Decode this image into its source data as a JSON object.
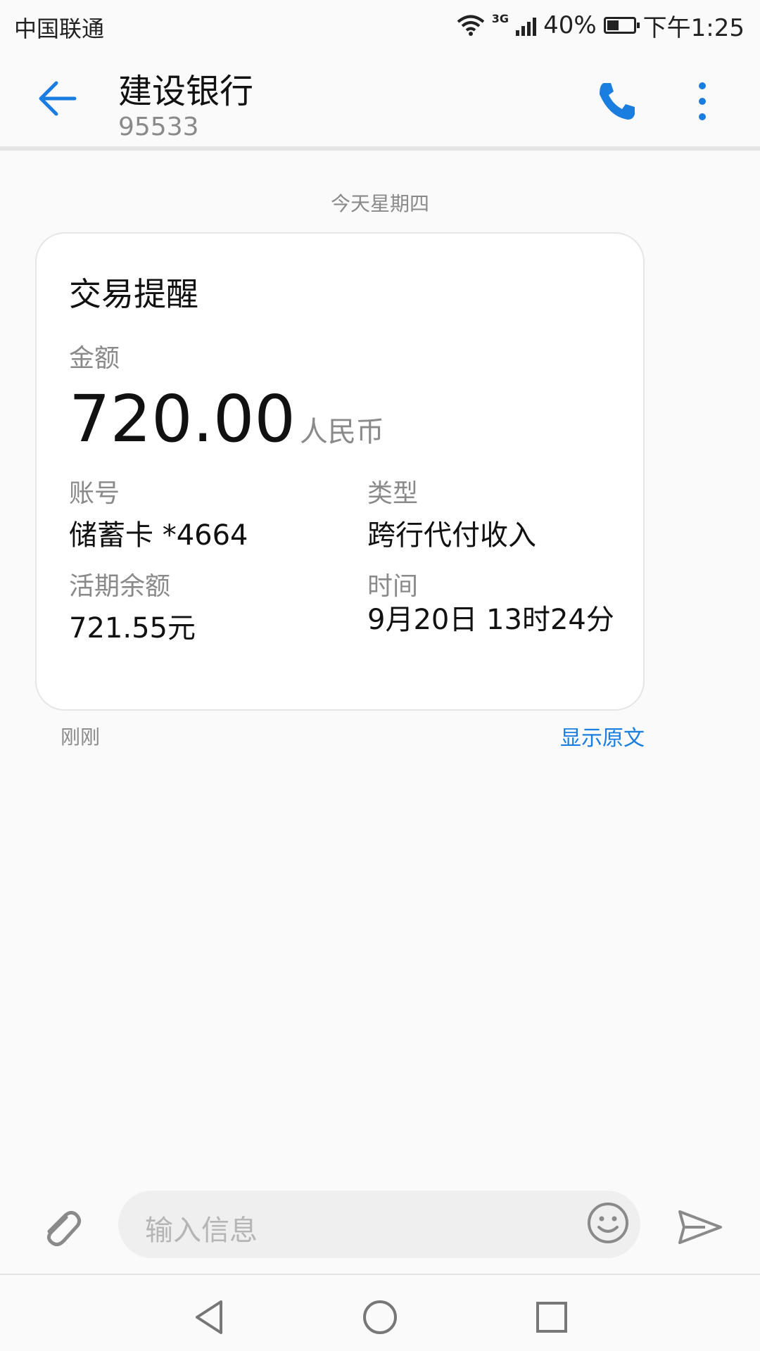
{
  "status_bar": {
    "carrier": "中国联通",
    "network": "3G",
    "battery": "40%",
    "battery_level": 0.4,
    "time": "下午1:25"
  },
  "header": {
    "title": "建设银行",
    "subtitle": "95533",
    "back_icon": "arrow-left-icon",
    "call_icon": "phone-icon",
    "more_icon": "more-vertical-icon",
    "accent_color": "#1a7de0"
  },
  "conversation": {
    "date_separator": "今天星期四"
  },
  "message": {
    "card_title": "交易提醒",
    "amount_label": "金额",
    "amount": "720.00",
    "currency": "人民币",
    "account_label": "账号",
    "account_value": "储蓄卡 *4664",
    "type_label": "类型",
    "type_value": "跨行代付收入",
    "balance_label": "活期余额",
    "balance_value": "721.55元",
    "time_label": "时间",
    "time_value": "9月20日 13时24分",
    "sent_time": "刚刚",
    "show_original": "显示原文"
  },
  "composer": {
    "placeholder": "输入信息",
    "attach_icon": "paperclip-icon",
    "emoji_icon": "smiley-icon",
    "send_icon": "send-icon"
  },
  "navbar": {
    "back_icon": "triangle-back-icon",
    "home_icon": "circle-home-icon",
    "recent_icon": "square-recent-icon"
  }
}
